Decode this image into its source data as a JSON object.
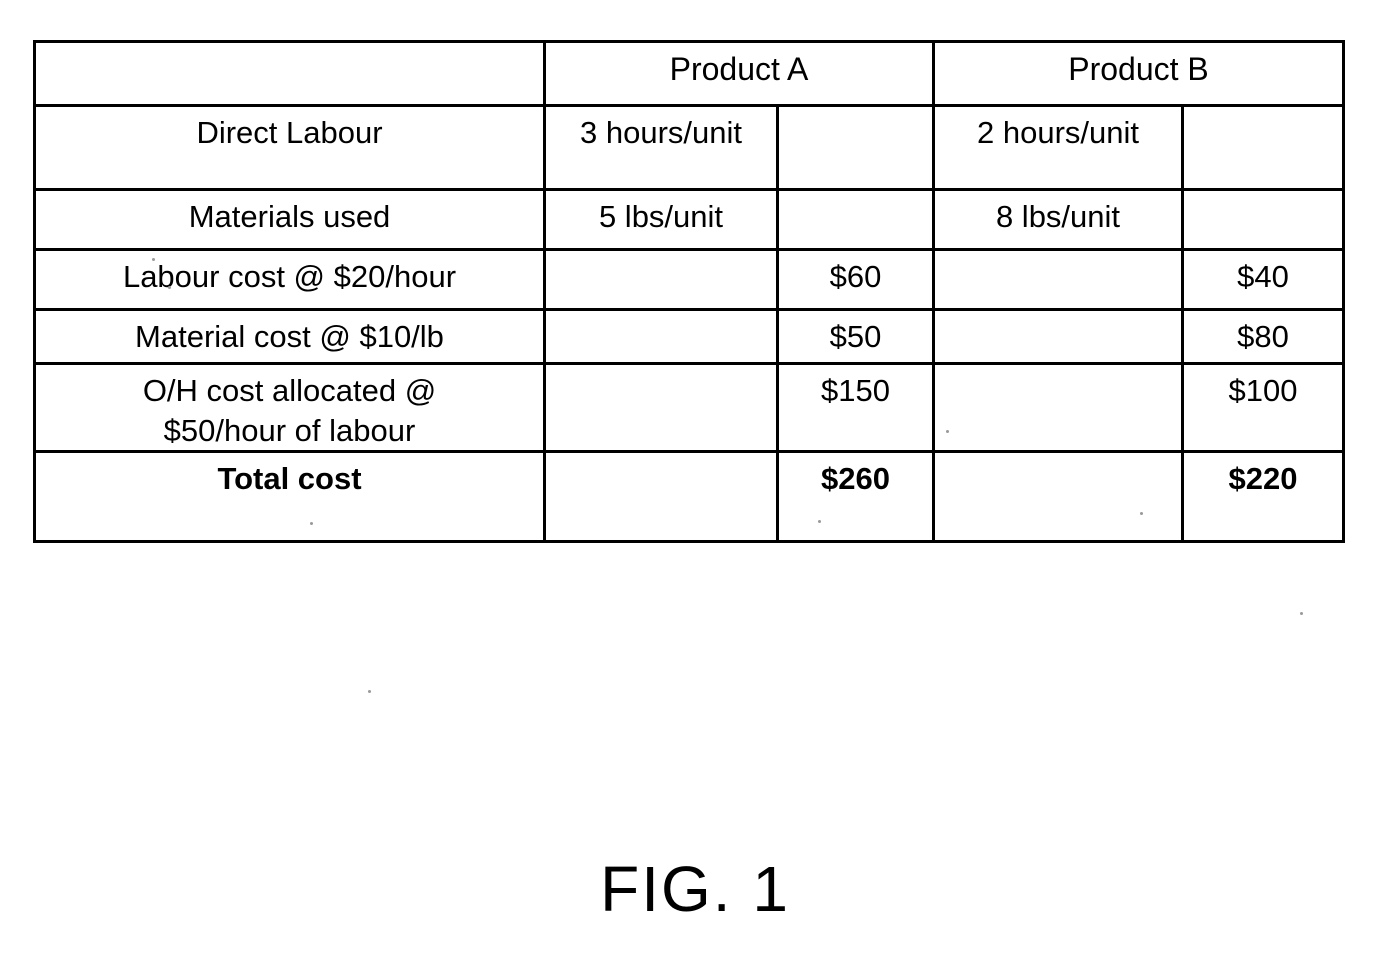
{
  "figure": {
    "caption": "FIG. 1"
  },
  "table": {
    "header": {
      "row_label": "",
      "product_a": "Product A",
      "product_b": "Product B"
    },
    "rows": [
      {
        "label": "Direct Labour",
        "a_qty": "3 hours/unit",
        "a_cost": "",
        "b_qty": "2 hours/unit",
        "b_cost": "",
        "bold": false
      },
      {
        "label": "Materials used",
        "a_qty": "5 lbs/unit",
        "a_cost": "",
        "b_qty": "8 lbs/unit",
        "b_cost": "",
        "bold": false
      },
      {
        "label": "Labour cost @ $20/hour",
        "a_qty": "",
        "a_cost": "$60",
        "b_qty": "",
        "b_cost": "$40",
        "bold": false
      },
      {
        "label": "Material cost @ $10/lb",
        "a_qty": "",
        "a_cost": "$50",
        "b_qty": "",
        "b_cost": "$80",
        "bold": false
      },
      {
        "label": "O/H cost allocated @ $50/hour of labour",
        "label_line1": "O/H cost allocated @",
        "label_line2": "$50/hour of labour",
        "a_qty": "",
        "a_cost": "$150",
        "b_qty": "",
        "b_cost": "$100",
        "bold": false
      },
      {
        "label": "Total cost",
        "a_qty": "",
        "a_cost": "$260",
        "b_qty": "",
        "b_cost": "$220",
        "bold": true
      }
    ]
  },
  "chart_data": {
    "type": "table",
    "title": "FIG. 1",
    "columns": [
      "",
      "Product A (quantity)",
      "Product A (cost)",
      "Product B (quantity)",
      "Product B (cost)"
    ],
    "rows": [
      [
        "Direct Labour",
        "3 hours/unit",
        "",
        "2 hours/unit",
        ""
      ],
      [
        "Materials used",
        "5 lbs/unit",
        "",
        "8 lbs/unit",
        ""
      ],
      [
        "Labour cost @ $20/hour",
        "",
        "$60",
        "",
        "$40"
      ],
      [
        "Material cost @ $10/lb",
        "",
        "$50",
        "",
        "$80"
      ],
      [
        "O/H cost allocated @ $50/hour of labour",
        "",
        "$150",
        "",
        "$100"
      ],
      [
        "Total cost",
        "",
        "$260",
        "",
        "$220"
      ]
    ]
  },
  "colors": {
    "ink": "#000000",
    "paper": "#ffffff"
  }
}
